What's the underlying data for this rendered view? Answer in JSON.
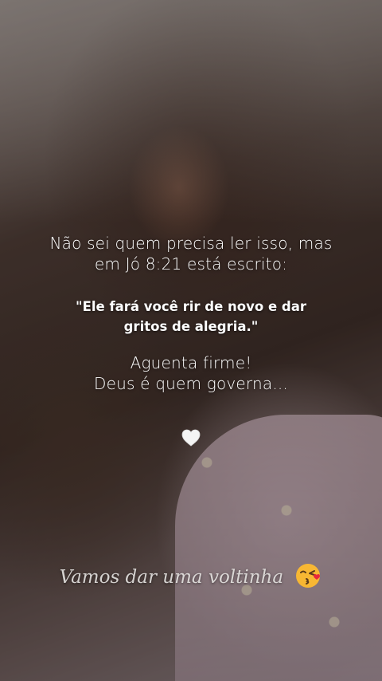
{
  "story": {
    "line1": "Não sei quem precisa ler isso, mas",
    "line2": "em Jó 8:21 está escrito:",
    "quote_line1": "\"Ele fará você rir de novo e dar",
    "quote_line2": "gritos de alegria.\"",
    "line3": "Aguenta firme!",
    "line4": "Deus é quem governa...",
    "heart_icon": "white-heart-icon",
    "caption": "Vamos dar uma voltinha",
    "caption_emoji": "face-blowing-kiss-icon"
  },
  "colors": {
    "text": "#ffffff",
    "caption_text": "#ebe8e6",
    "heart": "#f4f4f4",
    "emoji_face": "#f7b733",
    "emoji_heart": "#e8283c"
  }
}
